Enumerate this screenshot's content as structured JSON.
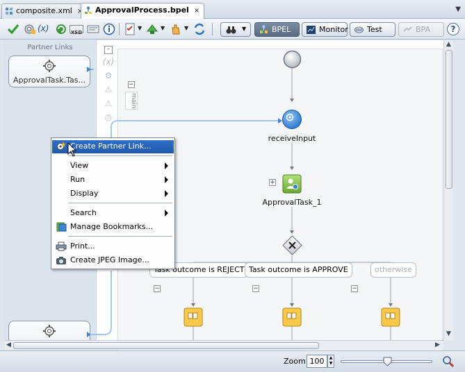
{
  "tabs": [
    {
      "label": "composite.xml",
      "close": "×",
      "active": false
    },
    {
      "label": "ApprovalProcess.bpel",
      "close": "×",
      "active": true
    }
  ],
  "tab_dropdown": "▼",
  "toolbar": {
    "expr_label": "(x)",
    "xsd_label": "XSD",
    "buttons": [
      "validate-icon",
      "settings-icon",
      "variables-icon",
      "refresh-icon",
      "xsd-icon",
      "xml-icon",
      "info-icon",
      "checklist-icon",
      "deploy-icon",
      "hand-icon",
      "sync-icon"
    ],
    "pills": [
      {
        "label": "",
        "icon": "binoculars-icon"
      },
      {
        "label": "BPEL",
        "icon": "bpel-icon"
      },
      {
        "label": "Monitor",
        "icon": "monitor-icon"
      },
      {
        "label": "Test",
        "icon": "test-icon"
      },
      {
        "label": "BPA",
        "icon": "bpa-icon",
        "disabled": true
      }
    ],
    "help": "?"
  },
  "partner_links": {
    "title": "Partner Links",
    "items": [
      {
        "label": "ApprovalTask.Tas..."
      },
      {
        "label": ""
      }
    ]
  },
  "canvas": {
    "scope_label": "main",
    "palette": [
      "-",
      "(x)",
      "gear-icon",
      "warning-icon",
      "warning-icon",
      "clock-icon"
    ],
    "nodes": [
      {
        "type": "start",
        "label": ""
      },
      {
        "type": "receive",
        "label": "receiveInput"
      },
      {
        "type": "human-task",
        "label": "ApprovalTask_1"
      },
      {
        "type": "switch",
        "label": ""
      }
    ],
    "branches": [
      {
        "label": "Task outcome is REJECT"
      },
      {
        "label": "Task outcome is APPROVE"
      },
      {
        "label": "otherwise"
      }
    ]
  },
  "context_menu": {
    "items": [
      {
        "label": "Create Partner Link...",
        "icon": "create-partner-link-icon",
        "highlighted": true
      },
      {
        "label": "View",
        "submenu": true
      },
      {
        "label": "Run",
        "submenu": true
      },
      {
        "label": "Display",
        "submenu": true
      },
      {
        "label": "Search",
        "submenu": true
      },
      {
        "label": "Manage Bookmarks...",
        "icon": "bookmarks-icon"
      },
      {
        "label": "Print...",
        "icon": "print-icon"
      },
      {
        "label": "Create JPEG Image...",
        "icon": "camera-icon"
      }
    ]
  },
  "statusbar": {
    "zoom_label": "Zoom:",
    "zoom_value": "100",
    "zoom_level_fraction": 0.5
  },
  "colors": {
    "selection": "#1f58ad",
    "bpel_pill": "#5a6a80",
    "receive_node": "#2f7fd1",
    "task_node": "#7cb342",
    "case_node": "#f3c340"
  }
}
